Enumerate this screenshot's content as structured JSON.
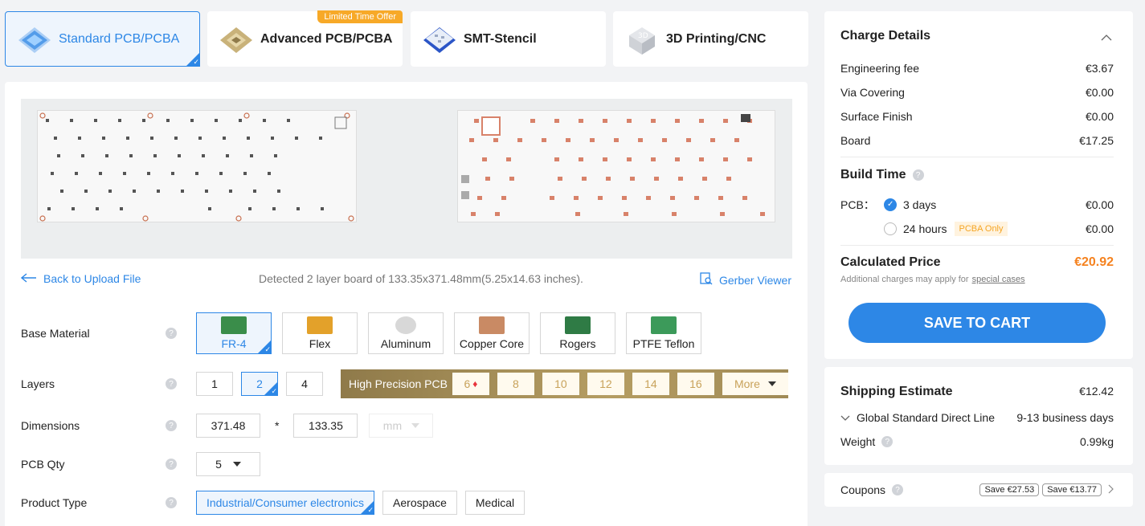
{
  "tabs": [
    {
      "label": "Standard PCB/PCBA",
      "icon": "standard-pcb-icon",
      "active": true
    },
    {
      "label": "Advanced PCB/PCBA",
      "icon": "advanced-pcb-icon",
      "badge": "Limited Time Offer"
    },
    {
      "label": "SMT-Stencil",
      "icon": "smt-stencil-icon"
    },
    {
      "label": "3D Printing/CNC",
      "icon": "3d-printing-icon"
    }
  ],
  "actions": {
    "back_label": "Back to Upload File",
    "detected": "Detected 2 layer board of 133.35x371.48mm(5.25x14.63 inches).",
    "gerber_label": "Gerber Viewer"
  },
  "form": {
    "base_material": {
      "label": "Base Material",
      "options": [
        "FR-4",
        "Flex",
        "Aluminum",
        "Copper Core",
        "Rogers",
        "PTFE Teflon"
      ],
      "selected": "FR-4"
    },
    "layers": {
      "label": "Layers",
      "options": [
        "1",
        "2",
        "4"
      ],
      "selected": "2",
      "high_precision_label": "High Precision PCB",
      "high_precision_options": [
        "6",
        "8",
        "10",
        "12",
        "14",
        "16"
      ],
      "more_label": "More"
    },
    "dimensions": {
      "label": "Dimensions",
      "length": "371.48",
      "separator": "*",
      "width": "133.35",
      "unit": "mm"
    },
    "pcb_qty": {
      "label": "PCB Qty",
      "value": "5"
    },
    "product_type": {
      "label": "Product Type",
      "options": [
        "Industrial/Consumer electronics",
        "Aerospace",
        "Medical"
      ],
      "selected": "Industrial/Consumer electronics"
    }
  },
  "charge": {
    "title": "Charge Details",
    "items": [
      {
        "label": "Engineering fee",
        "value": "€3.67"
      },
      {
        "label": "Via Covering",
        "value": "€0.00"
      },
      {
        "label": "Surface Finish",
        "value": "€0.00"
      },
      {
        "label": "Board",
        "value": "€17.25"
      }
    ],
    "build_time": {
      "title": "Build Time",
      "pcb_label": "PCB：",
      "options": [
        {
          "label": "3 days",
          "value": "€0.00",
          "selected": true
        },
        {
          "label": "24 hours",
          "value": "€0.00",
          "tag": "PCBA Only"
        }
      ]
    },
    "calculated_label": "Calculated Price",
    "calculated_value": "€20.92",
    "note_prefix": "Additional charges may apply for",
    "note_link": "special cases",
    "cart_label": "SAVE TO CART"
  },
  "shipping": {
    "title": "Shipping Estimate",
    "price": "€12.42",
    "method": "Global Standard Direct Line",
    "days": "9-13 business days",
    "weight_label": "Weight",
    "weight_value": "0.99kg"
  },
  "coupons": {
    "label": "Coupons",
    "items": [
      "Save €27.53",
      "Save €13.77"
    ]
  },
  "colors": {
    "accent": "#2d87e6",
    "price": "#f5821f",
    "gold": "#b59d62",
    "promo": "#f7a928"
  }
}
